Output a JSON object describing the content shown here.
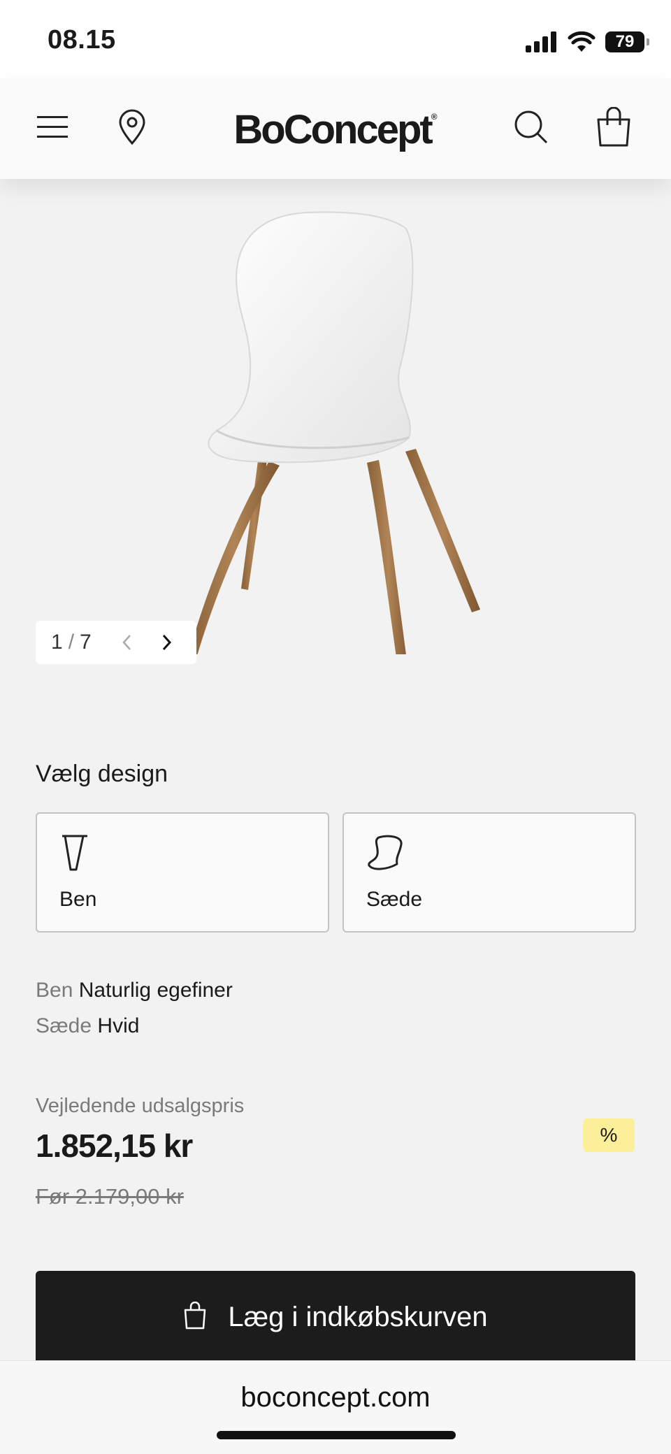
{
  "status_bar": {
    "time": "08.15",
    "battery": "79"
  },
  "header": {
    "logo": "BoConcept",
    "logo_mark": "®"
  },
  "gallery": {
    "current": "1",
    "separator": "/",
    "total": "7"
  },
  "design": {
    "title": "Vælg design",
    "options": [
      {
        "label": "Ben",
        "icon": "leg-icon"
      },
      {
        "label": "Sæde",
        "icon": "seat-icon"
      }
    ]
  },
  "specs": [
    {
      "key": "Ben",
      "value": "Naturlig egefiner"
    },
    {
      "key": "Sæde",
      "value": "Hvid"
    }
  ],
  "pricing": {
    "label": "Vejledende udsalgspris",
    "price": "1.852,15 kr",
    "old_price": "Før 2.179,00 kr",
    "badge": "%"
  },
  "cta": {
    "label": "Læg i indkøbskurven"
  },
  "browser": {
    "url": "boconcept.com"
  },
  "colors": {
    "background": "#f2f2f2",
    "button": "#1c1c1c",
    "badge": "#fcef9a"
  }
}
